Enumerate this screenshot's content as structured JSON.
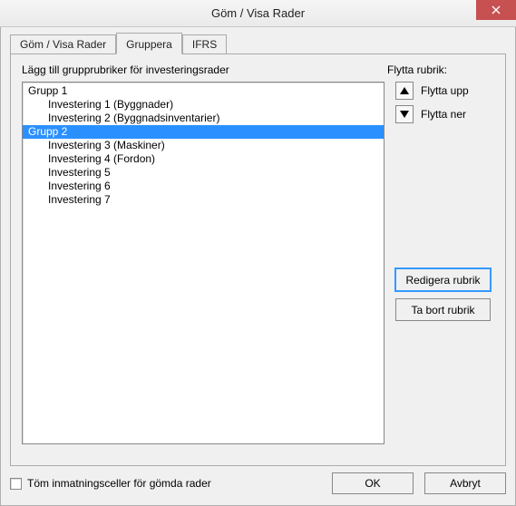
{
  "title": "Göm / Visa Rader",
  "tabs": [
    {
      "label": "Göm / Visa Rader",
      "active": false
    },
    {
      "label": "Gruppera",
      "active": true
    },
    {
      "label": "IFRS",
      "active": false
    }
  ],
  "panel": {
    "heading": "Lägg till grupprubriker för investeringsrader",
    "move_header": "Flytta rubrik:",
    "move_up": "Flytta upp",
    "move_down": "Flytta ner",
    "edit_button": "Redigera rubrik",
    "delete_button": "Ta bort rubrik"
  },
  "list": [
    {
      "label": "Grupp 1",
      "indent": 0,
      "selected": false
    },
    {
      "label": "Investering 1 (Byggnader)",
      "indent": 1,
      "selected": false
    },
    {
      "label": "Investering 2 (Byggnadsinventarier)",
      "indent": 1,
      "selected": false
    },
    {
      "label": "Grupp 2",
      "indent": 0,
      "selected": true
    },
    {
      "label": "Investering 3 (Maskiner)",
      "indent": 1,
      "selected": false
    },
    {
      "label": "Investering 4 (Fordon)",
      "indent": 1,
      "selected": false
    },
    {
      "label": "Investering 5",
      "indent": 1,
      "selected": false
    },
    {
      "label": "Investering 6",
      "indent": 1,
      "selected": false
    },
    {
      "label": "Investering 7",
      "indent": 1,
      "selected": false
    }
  ],
  "footer": {
    "checkbox_label": "Töm inmatningsceller för gömda rader",
    "ok": "OK",
    "cancel": "Avbryt"
  }
}
